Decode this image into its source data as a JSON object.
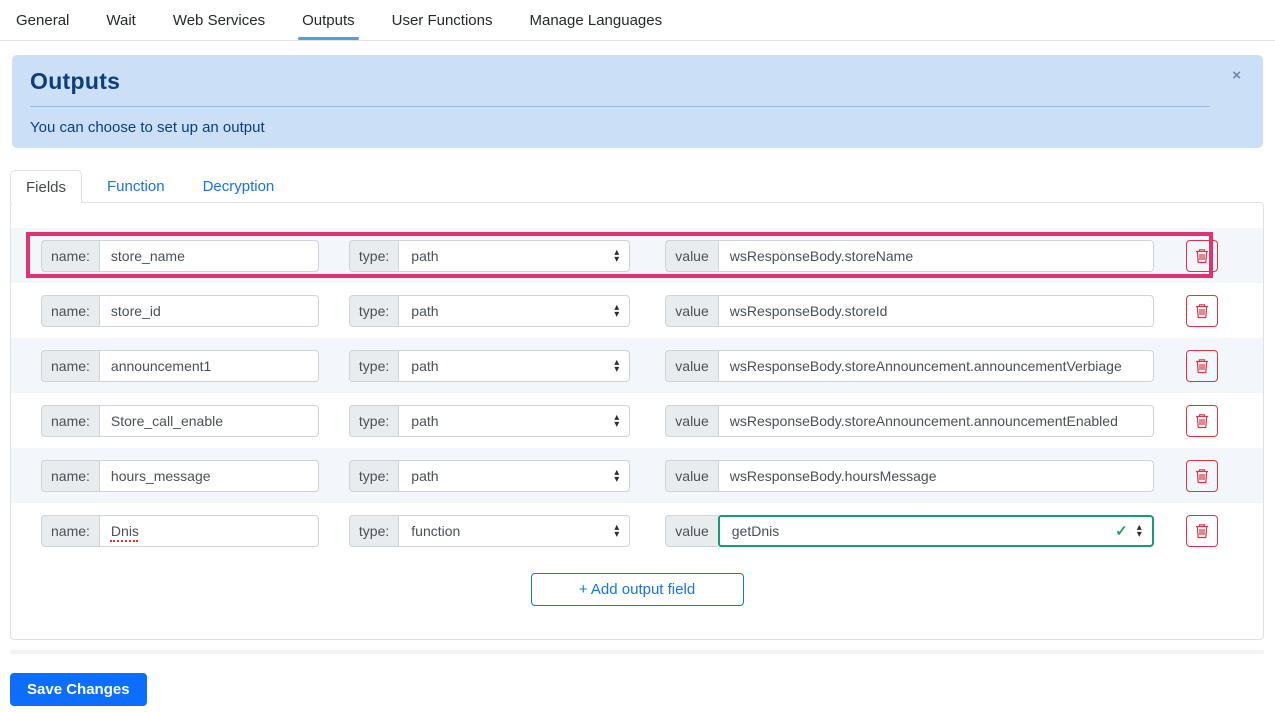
{
  "nav": {
    "items": [
      {
        "label": "General",
        "active": false
      },
      {
        "label": "Wait",
        "active": false
      },
      {
        "label": "Web Services",
        "active": false
      },
      {
        "label": "Outputs",
        "active": true
      },
      {
        "label": "User Functions",
        "active": false
      },
      {
        "label": "Manage Languages",
        "active": false
      }
    ]
  },
  "banner": {
    "title": "Outputs",
    "message": "You can choose to set up an output"
  },
  "tabs": [
    {
      "label": "Fields",
      "active": true
    },
    {
      "label": "Function",
      "active": false
    },
    {
      "label": "Decryption",
      "active": false
    }
  ],
  "icons": {
    "close": "×",
    "caret_up": "▴",
    "caret_down": "▾",
    "check": "✓"
  },
  "fields": {
    "labels": {
      "name": "name:",
      "type": "type:",
      "value": "value"
    },
    "rows": [
      {
        "name": "store_name",
        "type": "path",
        "value": "wsResponseBody.storeName",
        "highlighted": true
      },
      {
        "name": "store_id",
        "type": "path",
        "value": "wsResponseBody.storeId",
        "highlighted": false
      },
      {
        "name": "announcement1",
        "type": "path",
        "value": "wsResponseBody.storeAnnouncement.announcementVerbiage",
        "highlighted": false
      },
      {
        "name": "Store_call_enable",
        "type": "path",
        "value": "wsResponseBody.storeAnnouncement.announcementEnabled",
        "highlighted": false
      },
      {
        "name": "hours_message",
        "type": "path",
        "value": "wsResponseBody.hoursMessage",
        "highlighted": false
      },
      {
        "name": "Dnis",
        "type": "function",
        "value": "getDnis",
        "highlighted": false,
        "valid": true,
        "spellcheck_marked": true
      }
    ],
    "add_button_label": "+ Add output field"
  },
  "footer": {
    "save_button_label": "Save Changes"
  },
  "colors": {
    "highlight_frame": "#dd3470",
    "accent_blue": "#1574e8",
    "nav_underline": "#5b97ea",
    "banner_bg": "#cbdff7",
    "banner_text": "#0c3e7c",
    "danger_red": "#dc3545",
    "valid_border": "#17997a",
    "check_green": "#23a15d",
    "save_button_bg": "#0d6efd",
    "row_stripe": "#f3f6fb"
  }
}
